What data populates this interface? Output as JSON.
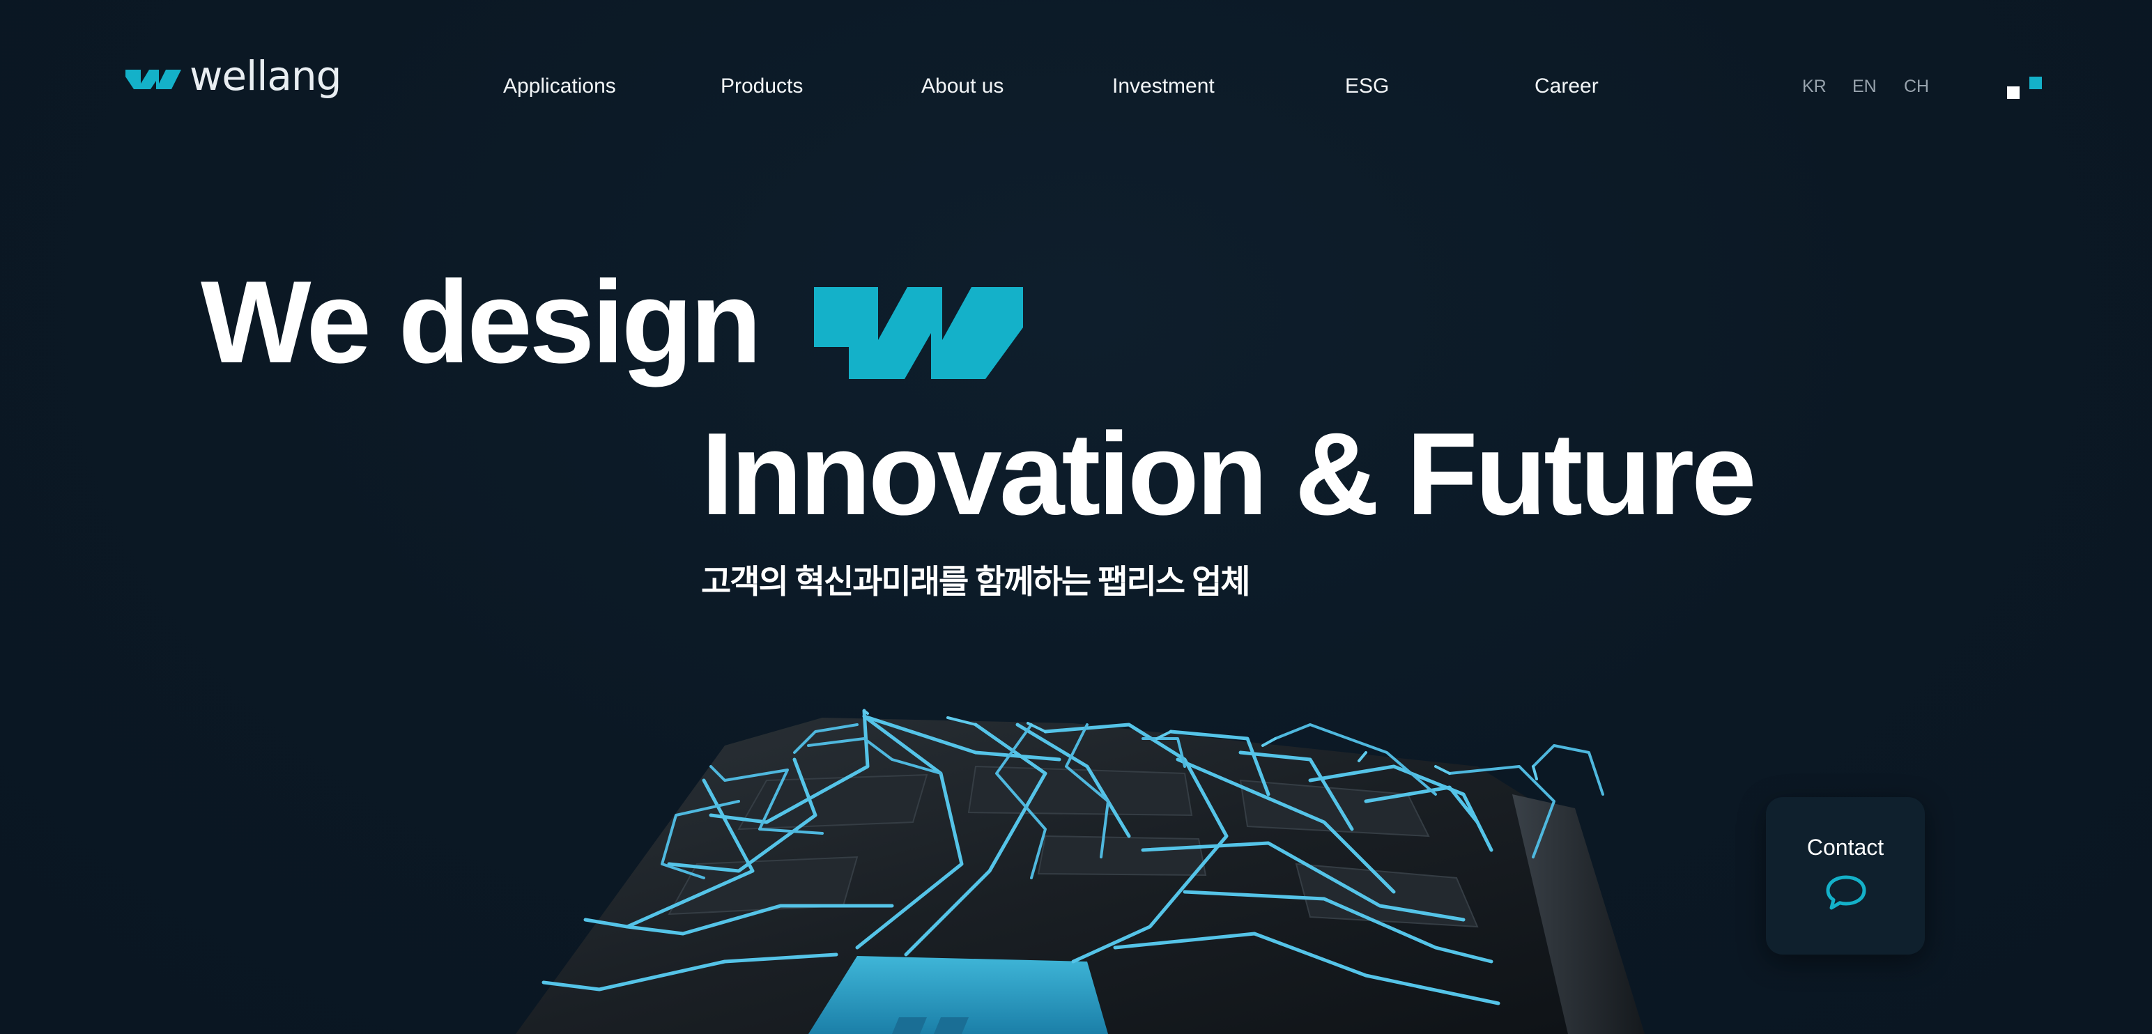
{
  "brand": {
    "name": "wellang",
    "accent_color": "#14b1c9"
  },
  "nav": {
    "items": [
      {
        "label": "Applications"
      },
      {
        "label": "Products"
      },
      {
        "label": "About us"
      },
      {
        "label": "Investment"
      },
      {
        "label": "ESG"
      },
      {
        "label": "Career"
      }
    ],
    "languages": [
      "KR",
      "EN",
      "CH"
    ],
    "menu_icon": "menu-squares-icon"
  },
  "hero": {
    "line1": "We design",
    "line1_icon": "wellang-w-mark-icon",
    "line2": "Innovation & Future",
    "subtitle": "고객의 혁신과미래를 함께하는 팹리스 업체"
  },
  "contact": {
    "label": "Contact",
    "icon": "chat-bubble-icon"
  }
}
